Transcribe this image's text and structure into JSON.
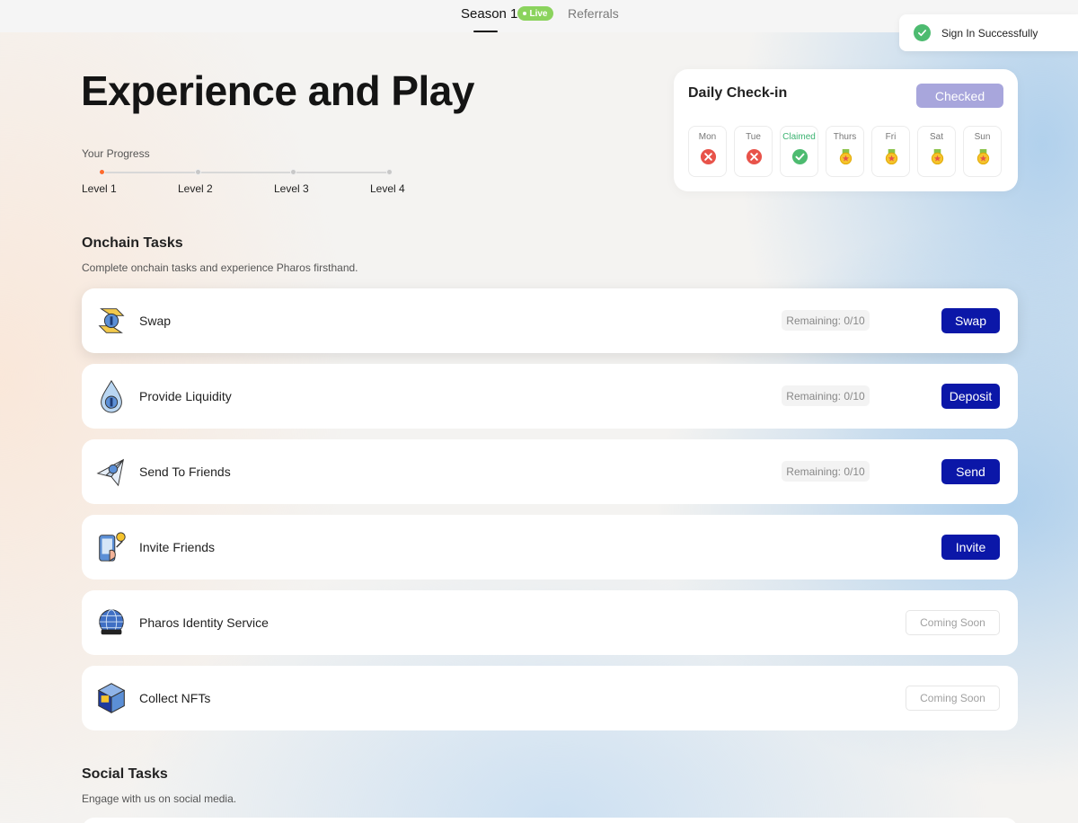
{
  "nav": {
    "season_tab": "Season 1",
    "live_badge": "Live",
    "referrals_tab": "Referrals"
  },
  "toast": {
    "message": "Sign In Successfully",
    "icon": "check-circle-icon"
  },
  "headline": "Experience and Play",
  "progress": {
    "label": "Your Progress",
    "current_level": 1,
    "levels": [
      "Level 1",
      "Level 2",
      "Level 3",
      "Level 4"
    ]
  },
  "checkin": {
    "title": "Daily Check-in",
    "button": "Checked",
    "days": [
      {
        "label": "Mon",
        "status": "missed"
      },
      {
        "label": "Tue",
        "status": "missed"
      },
      {
        "label": "Claimed",
        "status": "claimed"
      },
      {
        "label": "Thurs",
        "status": "medal"
      },
      {
        "label": "Fri",
        "status": "medal"
      },
      {
        "label": "Sat",
        "status": "medal"
      },
      {
        "label": "Sun",
        "status": "medal"
      }
    ]
  },
  "onchain": {
    "title": "Onchain Tasks",
    "subtitle": "Complete onchain tasks and experience Pharos firsthand.",
    "tasks": [
      {
        "name": "Swap",
        "remaining": "Remaining: 0/10",
        "button": "Swap",
        "icon": "swap-icon"
      },
      {
        "name": "Provide Liquidity",
        "remaining": "Remaining: 0/10",
        "button": "Deposit",
        "icon": "liquidity-drop-icon"
      },
      {
        "name": "Send To Friends",
        "remaining": "Remaining: 0/10",
        "button": "Send",
        "icon": "paper-plane-icon"
      },
      {
        "name": "Invite Friends",
        "remaining": "",
        "button": "Invite",
        "icon": "invite-phone-icon"
      },
      {
        "name": "Pharos Identity Service",
        "remaining": "",
        "button": "Coming Soon",
        "icon": "globe-identity-icon"
      },
      {
        "name": "Collect NFTs",
        "remaining": "",
        "button": "Coming Soon",
        "icon": "nft-cube-icon"
      }
    ]
  },
  "social": {
    "title": "Social Tasks",
    "subtitle": "Engage with us on social media."
  },
  "colors": {
    "primary_button": "#0b17a8",
    "checked_button": "#a8a6dc",
    "live_badge": "#8bd35d",
    "progress_active": "#ff6a2b",
    "success": "#4dbb70",
    "missed": "#e8534a"
  }
}
